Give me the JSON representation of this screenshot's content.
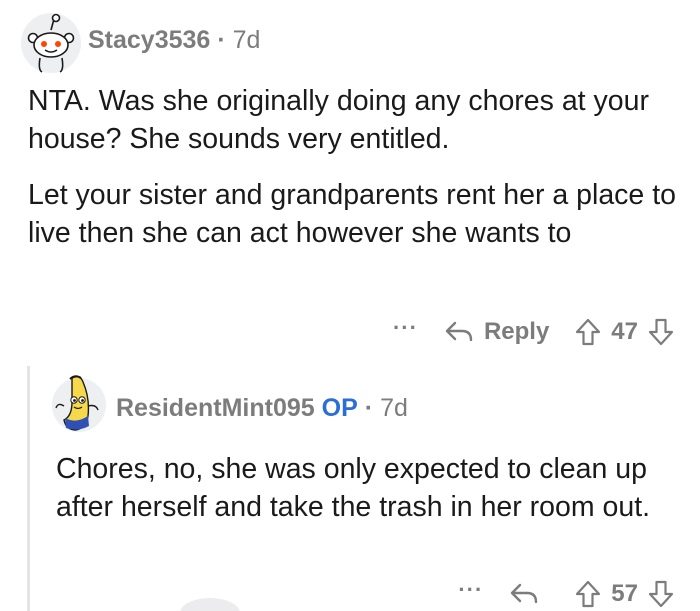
{
  "comment": {
    "username": "Stacy3536",
    "age": "7d",
    "paragraphs": [
      "NTA. Was she originally doing any chores at your house? She sounds very entitled.",
      "Let your sister and grandparents rent her a place to live then she can act however she wants to"
    ],
    "more_label": "···",
    "reply_label": "Reply",
    "vote_count": "47"
  },
  "reply": {
    "username": "ResidentMint095",
    "op_badge": "OP",
    "age": "7d",
    "paragraphs": [
      "Chores, no, she was only expected to clean up after herself and take the trash in her room out."
    ],
    "more_label": "···",
    "vote_count": "57"
  },
  "colors": {
    "meta_gray": "#7c7c7c",
    "op_blue": "#2b6ed6",
    "text": "#1a1a1b",
    "thread_line": "#e4e4e6"
  },
  "icons": [
    "snoo-avatar-icon",
    "banana-avatar-icon",
    "reply-arrow-icon",
    "upvote-arrow-icon",
    "downvote-arrow-icon",
    "more-options-icon"
  ]
}
